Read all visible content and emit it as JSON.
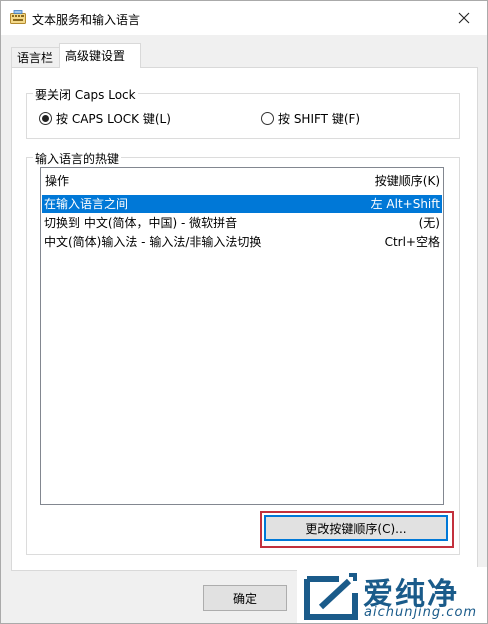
{
  "window": {
    "title": "文本服务和输入语言"
  },
  "tabs": [
    {
      "label": "语言栏",
      "active": false
    },
    {
      "label": "高级键设置",
      "active": true
    }
  ],
  "caps_lock_group": {
    "legend": "要关闭 Caps Lock",
    "options": [
      {
        "label": "按 CAPS LOCK 键(L)",
        "checked": true
      },
      {
        "label": "按 SHIFT 键(F)",
        "checked": false
      }
    ]
  },
  "hotkeys_group": {
    "legend": "输入语言的热键",
    "columns": {
      "action": "操作",
      "key_sequence": "按键顺序(K)"
    },
    "rows": [
      {
        "action": "在输入语言之间",
        "keys": "左 Alt+Shift",
        "selected": true
      },
      {
        "action": "切换到 中文(简体，中国) - 微软拼音",
        "keys": "(无)",
        "selected": false
      },
      {
        "action": "中文(简体)输入法 - 输入法/非输入法切换",
        "keys": "Ctrl+空格",
        "selected": false
      }
    ],
    "change_button": "更改按键顺序(C)..."
  },
  "footer": {
    "ok_button": "确定"
  },
  "watermark": {
    "cn": "爱纯净",
    "url": "aichunjing.com"
  },
  "colors": {
    "selection": "#0078d7",
    "highlight_box": "#c3313d",
    "watermark": "#1a5b8a"
  }
}
